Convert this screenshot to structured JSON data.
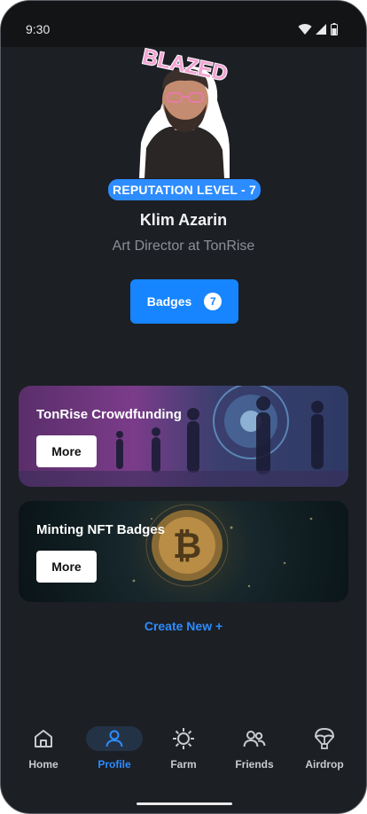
{
  "status": {
    "time": "9:30"
  },
  "profile": {
    "sticker_text": "BLAZED",
    "reputation": "REPUTATION LEVEL - 7",
    "name": "Klim Azarin",
    "title": "Art Director at TonRise",
    "badges_label": "Badges",
    "badges_count": "7"
  },
  "cards": [
    {
      "title": "TonRise Crowdfunding",
      "button": "More"
    },
    {
      "title": "Minting NFT Badges",
      "button": "More"
    }
  ],
  "create_new": "Create New +",
  "nav": [
    {
      "label": "Home",
      "icon": "home-icon"
    },
    {
      "label": "Profile",
      "icon": "person-icon",
      "active": true
    },
    {
      "label": "Farm",
      "icon": "sun-icon"
    },
    {
      "label": "Friends",
      "icon": "friends-icon"
    },
    {
      "label": "Airdrop",
      "icon": "parachute-icon"
    }
  ],
  "colors": {
    "accent": "#2d8cff",
    "background": "#1c1f24",
    "nav_active_pill": "#243246"
  }
}
